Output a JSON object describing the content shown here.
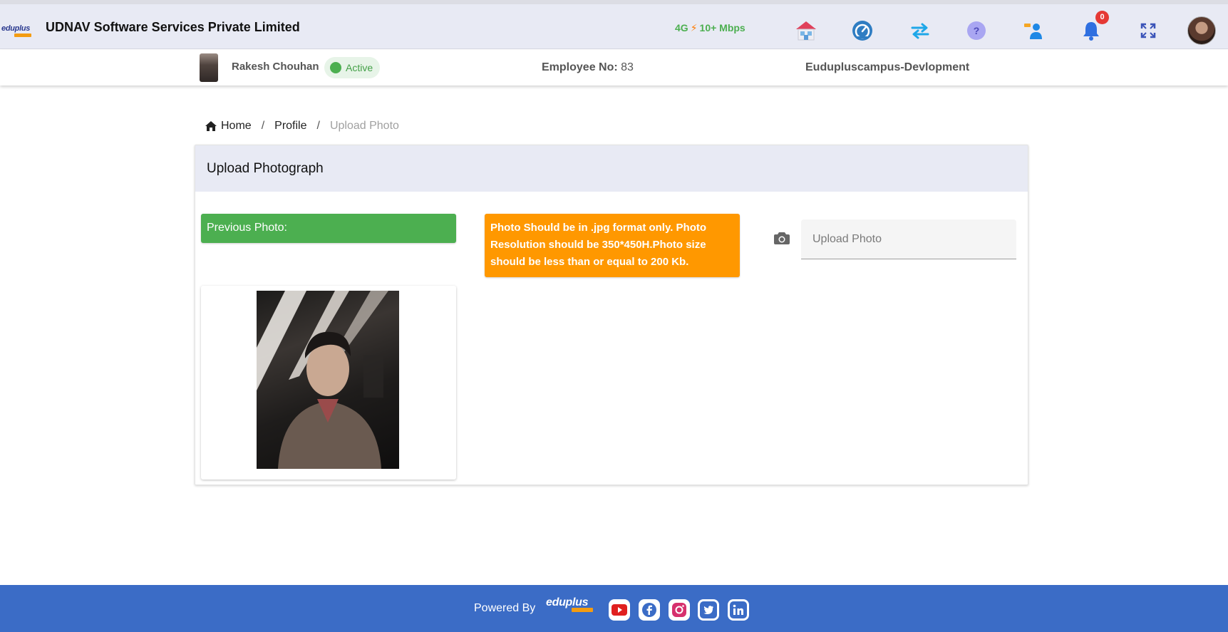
{
  "header": {
    "company": "UDNAV Software Services Private Limited",
    "logo_text": "eduplus",
    "network_type": "4G",
    "network_speed": "10+ Mbps",
    "notification_count": "0",
    "icons": [
      "home-icon",
      "dashboard-icon",
      "switch-icon",
      "help-icon",
      "people-icon",
      "bell-icon",
      "fullscreen-icon"
    ]
  },
  "employee": {
    "name": "Rakesh Chouhan",
    "status": "Active",
    "number_label": "Employee No:",
    "number": "83",
    "campus": "Euduplusc ampus-Devlopment"
  },
  "breadcrumb": {
    "home": "Home",
    "profile": "Profile",
    "current": "Upload Photo"
  },
  "card": {
    "title": "Upload Photograph",
    "previous_label": "Previous Photo:",
    "notice": "Photo Should be in .jpg format only. Photo Resolution should be 350*450H.Photo size should be less than or equal to 200 Kb.",
    "upload_placeholder": "Upload Photo"
  },
  "footer": {
    "powered_by": "Powered By",
    "logo_text": "eduplus",
    "social": [
      "youtube-icon",
      "facebook-icon",
      "instagram-icon",
      "twitter-icon",
      "linkedin-icon"
    ]
  },
  "colors": {
    "header_bg": "#e8eaf4",
    "success": "#4caf50",
    "warning": "#ff9800",
    "footer_bg": "#3b6cc6",
    "badge": "#e53935"
  }
}
